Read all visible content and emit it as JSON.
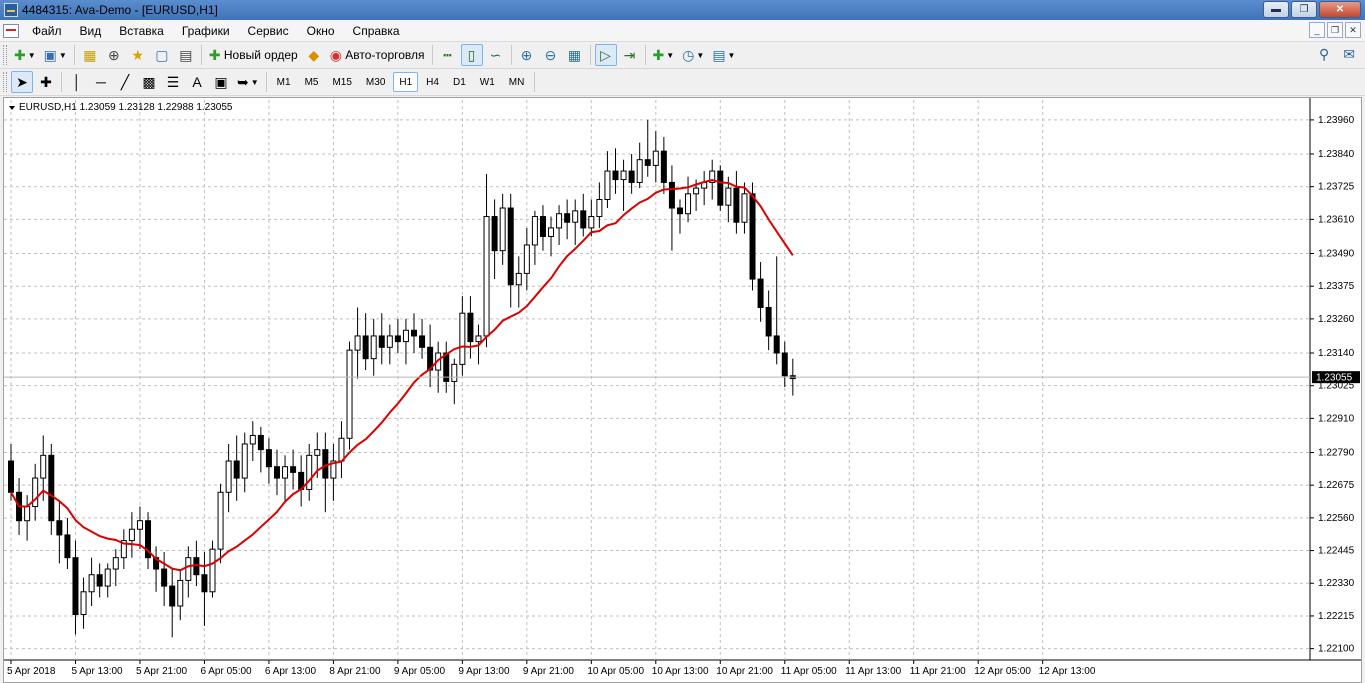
{
  "window": {
    "title": "4484315: Ava-Demo - [EURUSD,H1]"
  },
  "menu": {
    "items": [
      "Файл",
      "Вид",
      "Вставка",
      "Графики",
      "Сервис",
      "Окно",
      "Справка"
    ]
  },
  "toolbar": {
    "new_order": "Новый ордер",
    "auto_trading": "Авто-торговля"
  },
  "timeframes": [
    "M1",
    "M5",
    "M15",
    "M30",
    "H1",
    "H4",
    "D1",
    "W1",
    "MN"
  ],
  "active_timeframe": "H1",
  "colors": {
    "ma_line": "#dd0000",
    "candle_bull": "#ffffff",
    "candle_bear": "#000000",
    "grid": "#c0c0c0",
    "titlebar": "#4a7fc1"
  },
  "chart_data": {
    "type": "candlestick",
    "symbol_info": "EURUSD,H1  1.23059 1.23128 1.22988 1.23055",
    "current_price": "1.23055",
    "ylim": [
      1.2206,
      1.2403
    ],
    "y_ticks": [
      "1.23960",
      "1.23840",
      "1.23725",
      "1.23610",
      "1.23490",
      "1.23375",
      "1.23260",
      "1.23140",
      "1.23025",
      "1.22910",
      "1.22790",
      "1.22675",
      "1.22560",
      "1.22445",
      "1.22330",
      "1.22215",
      "1.22100"
    ],
    "x_ticks": [
      "5 Apr 2018",
      "5 Apr 13:00",
      "5 Apr 21:00",
      "6 Apr 05:00",
      "6 Apr 13:00",
      "8 Apr 21:00",
      "9 Apr 05:00",
      "9 Apr 13:00",
      "9 Apr 21:00",
      "10 Apr 05:00",
      "10 Apr 13:00",
      "10 Apr 21:00",
      "11 Apr 05:00",
      "11 Apr 13:00",
      "11 Apr 21:00",
      "12 Apr 05:00",
      "12 Apr 13:00"
    ],
    "grid": true,
    "ohlc": [
      [
        1.2276,
        1.2282,
        1.2262,
        1.2265
      ],
      [
        1.2265,
        1.227,
        1.225,
        1.2255
      ],
      [
        1.2255,
        1.2264,
        1.2248,
        1.226
      ],
      [
        1.226,
        1.2275,
        1.2255,
        1.227
      ],
      [
        1.227,
        1.2285,
        1.2262,
        1.2278
      ],
      [
        1.2278,
        1.2282,
        1.225,
        1.2255
      ],
      [
        1.2255,
        1.2262,
        1.224,
        1.225
      ],
      [
        1.225,
        1.2256,
        1.2238,
        1.2242
      ],
      [
        1.2242,
        1.2248,
        1.2215,
        1.2222
      ],
      [
        1.2222,
        1.2235,
        1.2217,
        1.223
      ],
      [
        1.223,
        1.2242,
        1.2225,
        1.2236
      ],
      [
        1.2236,
        1.224,
        1.2228,
        1.2232
      ],
      [
        1.2232,
        1.224,
        1.2228,
        1.2238
      ],
      [
        1.2238,
        1.2245,
        1.2232,
        1.2242
      ],
      [
        1.2242,
        1.2252,
        1.2238,
        1.2248
      ],
      [
        1.2248,
        1.2258,
        1.2242,
        1.2252
      ],
      [
        1.2252,
        1.226,
        1.2245,
        1.2255
      ],
      [
        1.2255,
        1.2258,
        1.2238,
        1.2242
      ],
      [
        1.2242,
        1.2246,
        1.223,
        1.2238
      ],
      [
        1.2238,
        1.2244,
        1.2225,
        1.2232
      ],
      [
        1.2232,
        1.2238,
        1.2214,
        1.2225
      ],
      [
        1.2225,
        1.2238,
        1.222,
        1.2234
      ],
      [
        1.2234,
        1.2246,
        1.2228,
        1.2242
      ],
      [
        1.2242,
        1.2248,
        1.2232,
        1.2236
      ],
      [
        1.2236,
        1.2244,
        1.2218,
        1.223
      ],
      [
        1.223,
        1.2248,
        1.2228,
        1.2245
      ],
      [
        1.2245,
        1.2268,
        1.224,
        1.2265
      ],
      [
        1.2265,
        1.2282,
        1.2258,
        1.2276
      ],
      [
        1.2276,
        1.2285,
        1.2262,
        1.227
      ],
      [
        1.227,
        1.2286,
        1.2265,
        1.2282
      ],
      [
        1.2282,
        1.229,
        1.2276,
        1.2285
      ],
      [
        1.2285,
        1.2288,
        1.2272,
        1.228
      ],
      [
        1.228,
        1.2284,
        1.2268,
        1.2274
      ],
      [
        1.2274,
        1.228,
        1.2264,
        1.227
      ],
      [
        1.227,
        1.2278,
        1.2262,
        1.2274
      ],
      [
        1.2274,
        1.228,
        1.2266,
        1.2272
      ],
      [
        1.2272,
        1.2278,
        1.226,
        1.2266
      ],
      [
        1.2266,
        1.2282,
        1.2262,
        1.2278
      ],
      [
        1.2278,
        1.2286,
        1.227,
        1.228
      ],
      [
        1.228,
        1.2286,
        1.2258,
        1.227
      ],
      [
        1.227,
        1.2282,
        1.2262,
        1.2276
      ],
      [
        1.2276,
        1.229,
        1.227,
        1.2284
      ],
      [
        1.2284,
        1.2318,
        1.228,
        1.2315
      ],
      [
        1.2315,
        1.233,
        1.2305,
        1.232
      ],
      [
        1.232,
        1.2328,
        1.2308,
        1.2312
      ],
      [
        1.2312,
        1.2326,
        1.2306,
        1.232
      ],
      [
        1.232,
        1.2328,
        1.231,
        1.2316
      ],
      [
        1.2316,
        1.2324,
        1.231,
        1.232
      ],
      [
        1.232,
        1.2326,
        1.2314,
        1.2318
      ],
      [
        1.2318,
        1.2326,
        1.231,
        1.2322
      ],
      [
        1.2322,
        1.2328,
        1.2314,
        1.232
      ],
      [
        1.232,
        1.2326,
        1.2312,
        1.2316
      ],
      [
        1.2316,
        1.2324,
        1.2302,
        1.2308
      ],
      [
        1.2308,
        1.2318,
        1.23,
        1.2314
      ],
      [
        1.2314,
        1.2318,
        1.23,
        1.2304
      ],
      [
        1.2304,
        1.2312,
        1.2296,
        1.231
      ],
      [
        1.231,
        1.2334,
        1.2306,
        1.2328
      ],
      [
        1.2328,
        1.2334,
        1.2312,
        1.2318
      ],
      [
        1.2318,
        1.2324,
        1.231,
        1.232
      ],
      [
        1.232,
        1.2377,
        1.2316,
        1.2362
      ],
      [
        1.2362,
        1.2368,
        1.234,
        1.235
      ],
      [
        1.235,
        1.237,
        1.2345,
        1.2365
      ],
      [
        1.2365,
        1.237,
        1.233,
        1.2338
      ],
      [
        1.2338,
        1.2348,
        1.233,
        1.2342
      ],
      [
        1.2342,
        1.2358,
        1.2336,
        1.2352
      ],
      [
        1.2352,
        1.2364,
        1.2345,
        1.2362
      ],
      [
        1.2362,
        1.2366,
        1.235,
        1.2355
      ],
      [
        1.2355,
        1.2362,
        1.2348,
        1.2358
      ],
      [
        1.2358,
        1.2366,
        1.2352,
        1.2363
      ],
      [
        1.2363,
        1.2368,
        1.2354,
        1.236
      ],
      [
        1.236,
        1.2368,
        1.2352,
        1.2364
      ],
      [
        1.2364,
        1.237,
        1.2355,
        1.2358
      ],
      [
        1.2358,
        1.2368,
        1.2355,
        1.2362
      ],
      [
        1.2362,
        1.2374,
        1.2358,
        1.2368
      ],
      [
        1.2368,
        1.2385,
        1.2365,
        1.2378
      ],
      [
        1.2378,
        1.2386,
        1.237,
        1.2375
      ],
      [
        1.2375,
        1.2382,
        1.2364,
        1.2378
      ],
      [
        1.2378,
        1.2384,
        1.237,
        1.2374
      ],
      [
        1.2374,
        1.2388,
        1.2372,
        1.2382
      ],
      [
        1.2382,
        1.2396,
        1.2376,
        1.238
      ],
      [
        1.238,
        1.2392,
        1.2374,
        1.2385
      ],
      [
        1.2385,
        1.239,
        1.237,
        1.2374
      ],
      [
        1.2374,
        1.238,
        1.235,
        1.2365
      ],
      [
        1.2365,
        1.2368,
        1.2356,
        1.2363
      ],
      [
        1.2363,
        1.2376,
        1.236,
        1.237
      ],
      [
        1.237,
        1.2375,
        1.2364,
        1.2372
      ],
      [
        1.2372,
        1.2378,
        1.2366,
        1.2374
      ],
      [
        1.2374,
        1.2382,
        1.2368,
        1.2378
      ],
      [
        1.2378,
        1.238,
        1.2364,
        1.2366
      ],
      [
        1.2366,
        1.2376,
        1.236,
        1.2372
      ],
      [
        1.2372,
        1.2378,
        1.2356,
        1.236
      ],
      [
        1.236,
        1.2374,
        1.2356,
        1.237
      ],
      [
        1.237,
        1.2374,
        1.2336,
        1.234
      ],
      [
        1.234,
        1.2346,
        1.2325,
        1.233
      ],
      [
        1.233,
        1.2336,
        1.2315,
        1.232
      ],
      [
        1.232,
        1.2348,
        1.231,
        1.2314
      ],
      [
        1.2314,
        1.2318,
        1.2302,
        1.2306
      ],
      [
        1.2306,
        1.2312,
        1.2299,
        1.2305
      ]
    ],
    "ma": {
      "period": 14,
      "type": "SMA"
    }
  }
}
